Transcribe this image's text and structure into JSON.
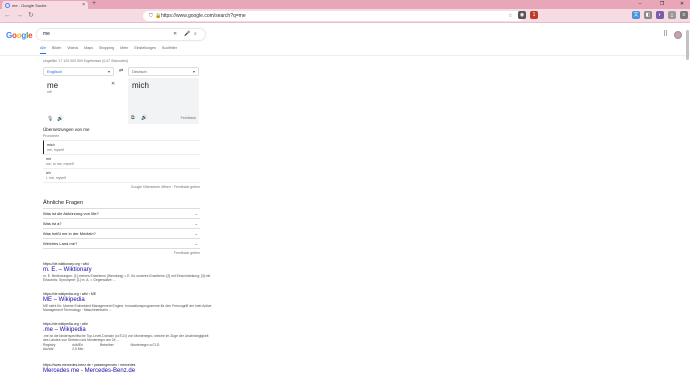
{
  "browser": {
    "tab_title": "me - Google Suche",
    "url": "https://www.google.com/search?q=me",
    "badge_count": "1"
  },
  "google": {
    "logo": "Google",
    "query": "me",
    "tabs": [
      "Alle",
      "Bilder",
      "Videos",
      "Maps",
      "Shopping",
      "Mehr",
      "Einstellungen",
      "Suchfilter"
    ],
    "stats": "Ungefähr 17 120 000 000 Ergebnisse (0,47 Sekunden)"
  },
  "translate": {
    "source_lang": "Englisch",
    "target_lang": "Deutsch",
    "source_word": "me",
    "source_phonetic": "mē",
    "target_word": "mich",
    "feedback": "Feedback",
    "translations_heading": "Übersetzungen von me",
    "pos": "Pronomen",
    "items": [
      {
        "word": "mich",
        "syn": "me, myself"
      },
      {
        "word": "mir",
        "syn": "me, to me, myself"
      },
      {
        "word": "ich",
        "syn": "I, me, myself"
      }
    ],
    "footer": "Google Übersetzer öffnen · Feedback geben"
  },
  "paa": {
    "heading": "Ähnliche Fragen",
    "questions": [
      "Was ist die Abkürzung von Me?",
      "Was ist a?",
      "Was heißt me in der Medizin?",
      "Welches Land me?"
    ],
    "feedback": "Feedback geben"
  },
  "results": [
    {
      "url": "https://de.wiktionary.org › wiki",
      "title": "m. E. – Wiktionary",
      "snippet": "m. E. Bedeutungen: [1] meines Erachtens (Wendung) = E. für unseres Erachtens; [2] mit Einschränkung; [3] mit Erlaubnis. Synonyme: [1] m. A. = Gegensätze: ..."
    },
    {
      "url": "https://de.wikipedia.org › wiki › ME",
      "title": "ME – Wikipedia",
      "snippet": "ME steht für: Marine Embedded Management Engine; Innovationsprogramme für den Fernzugriff der Intel Active Management Technology · Maschinenbahn ..."
    },
    {
      "url": "https://de.wikipedia.org › wiki",
      "title": ".me – Wikipedia",
      "snippet": ".me ist die länderspezifische Top-Level-Domain (ccTLD) von Montenegro, welche im Zuge der Unabhängigkeit des Landes von Serbien und Montenegro am 24 ...",
      "extra": [
        [
          "Registry",
          "doMEn"
        ],
        [
          "Betreiber",
          "Montenegro ccTLD"
        ],
        [
          "Anzahl",
          "2,5 Mio"
        ]
      ]
    },
    {
      "url": "https://www.mercedes-benz.de › passengercars › mercedes",
      "title": "Mercedes me - Mercedes-Benz.de"
    }
  ],
  "colors": {
    "tabbar": "#e8a7b9",
    "toolbar": "#f6dbe3",
    "link": "#1a0dab",
    "accent": "#1a73e8"
  }
}
